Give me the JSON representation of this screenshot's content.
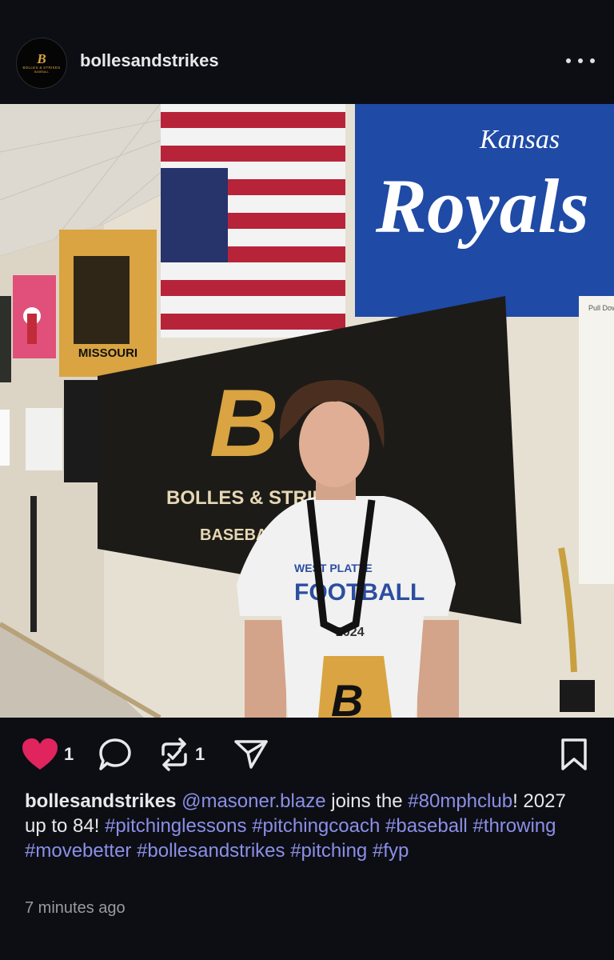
{
  "post": {
    "username": "bollesandstrikes",
    "avatar": {
      "letter": "B",
      "line1": "BOLLES & STRIKES",
      "line2": "BASEBALL"
    },
    "more_icon": "more-horizontal-icon"
  },
  "photo": {
    "flag_team": "Kansas",
    "flag_team_script": "Royals",
    "flag_missouri": "MISSOURI",
    "banner_letter": "B",
    "banner_line1": "BOLLES & STRIKES",
    "banner_line2": "BASEBALL",
    "shirt_line1": "WEST PLATTE",
    "shirt_line2": "FOOTBALL",
    "shirt_year": "2024",
    "pendant_letter": "B",
    "whiteboard_text": "Pull Down"
  },
  "actions": {
    "like_count": "1",
    "repost_count": "1",
    "like_color": "#e0245e",
    "icons": [
      "heart-icon",
      "comment-icon",
      "repost-icon",
      "share-icon",
      "bookmark-icon"
    ]
  },
  "caption": {
    "username": "bollesandstrikes",
    "mention": "@masoner.blaze",
    "text1": " joins the ",
    "tag1": "#80mphclub",
    "text2": "! 2027 up to 84! ",
    "tags": [
      "#pitchinglessons",
      "#pitchingcoach",
      "#baseball",
      "#throwing",
      "#movebetter",
      "#bollesandstrikes",
      "#pitching",
      "#fyp"
    ],
    "link_color": "#8c8fe6"
  },
  "timestamp": "7 minutes ago"
}
